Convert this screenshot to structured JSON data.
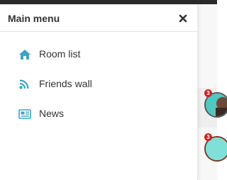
{
  "menu": {
    "title": "Main menu",
    "close_icon": "close-icon",
    "accent_color": "#3ba5c4",
    "items": [
      {
        "label": "Room list",
        "icon": "home-icon"
      },
      {
        "label": "Friends wall",
        "icon": "rss-icon"
      },
      {
        "label": "News",
        "icon": "newspaper-icon"
      }
    ]
  },
  "background": {
    "notifications": [
      {
        "badge": "3"
      },
      {
        "badge": "3"
      }
    ]
  }
}
